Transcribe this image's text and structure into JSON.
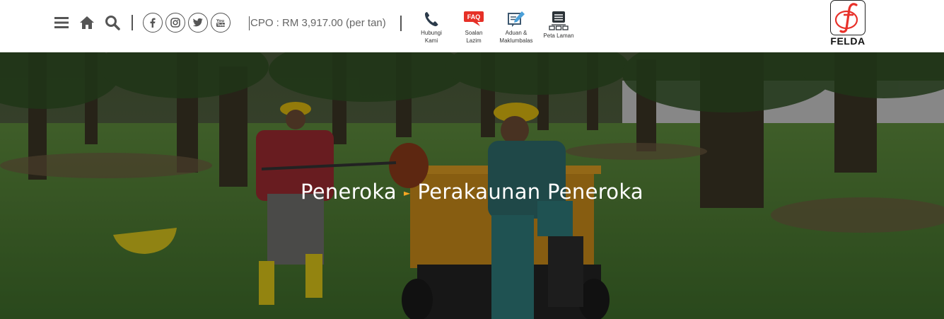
{
  "toolbar": {
    "menu_icon": "hamburger-menu-icon",
    "home_icon": "home-icon",
    "search_icon": "search-icon"
  },
  "social": [
    "facebook-icon",
    "instagram-icon",
    "twitter-icon",
    "youtube-icon"
  ],
  "cpo": {
    "text": "CPO : RM 3,917.00 (per tan)"
  },
  "quick_links": {
    "hubungi": {
      "line1": "Hubungi",
      "line2": "Kami"
    },
    "soalan": {
      "badge": "FAQ",
      "line1": "Soalan",
      "line2": "Lazim"
    },
    "aduan": {
      "line1": "Aduan &",
      "line2": "Maklumbalas"
    },
    "peta": {
      "line1": "Peta Laman"
    }
  },
  "logo": {
    "text": "FELDA",
    "colors": {
      "brand": "#e8312a",
      "border": "#222222"
    }
  },
  "breadcrumb": {
    "parent": "Peneroka",
    "current": "Perakaunan Peneroka",
    "arrow_color": "#f5a623"
  }
}
